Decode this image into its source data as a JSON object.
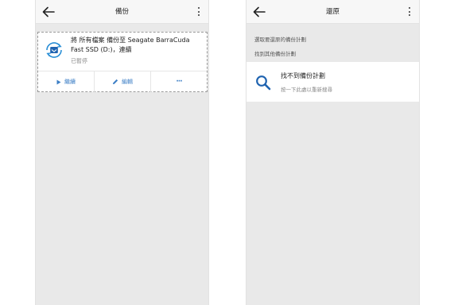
{
  "backup_screen": {
    "title": "備份",
    "plan_description": "將 所有檔案 備份至 Seagate BarraCuda Fast SSD (D:)，連續",
    "plan_status": "已暫停",
    "actions": {
      "resume": "繼續",
      "edit": "編輯",
      "more": "···"
    }
  },
  "restore_screen": {
    "title": "還原",
    "prompt": "選取要還原的備份計劃",
    "find_other": "找到其他備份計劃",
    "empty_title": "找不到備份計劃",
    "empty_subtitle": "按一下此處以重新搜尋"
  },
  "icons": {
    "back": "back-arrow-icon",
    "more": "more-vert-icon",
    "plan": "backup-sync-icon",
    "resume": "play-icon",
    "edit": "pencil-icon",
    "search": "search-icon"
  },
  "colors": {
    "accent": "#3d7fc6",
    "icon_blue": "#1f63b0"
  }
}
